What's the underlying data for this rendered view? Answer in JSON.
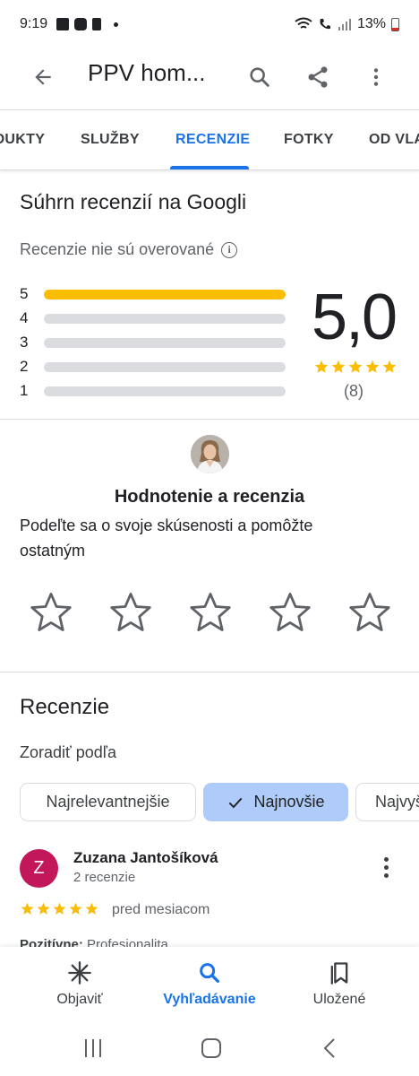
{
  "status_bar": {
    "time": "9:19",
    "battery": "13%"
  },
  "app_bar": {
    "title": "PPV hom..."
  },
  "tabs": [
    {
      "label": "PRODUKTY"
    },
    {
      "label": "SLUŽBY"
    },
    {
      "label": "RECENZIE",
      "active": true
    },
    {
      "label": "FOTKY"
    },
    {
      "label": "OD VLASTNÍKA"
    }
  ],
  "summary": {
    "title": "Súhrn recenzií na Googli",
    "unverified": "Recenzie nie sú overované",
    "distribution": [
      {
        "stars": "5",
        "fraction": 1.0
      },
      {
        "stars": "4",
        "fraction": 0.0
      },
      {
        "stars": "3",
        "fraction": 0.0
      },
      {
        "stars": "2",
        "fraction": 0.0
      },
      {
        "stars": "1",
        "fraction": 0.0
      }
    ],
    "score": "5,0",
    "star_rating": 5,
    "review_count": "(8)"
  },
  "rate": {
    "title": "Hodnotenie a recenzia",
    "description": "Podeľte sa o svoje skúsenosti a pomôžte ostatným"
  },
  "reviews": {
    "title": "Recenzie",
    "sort_label": "Zoradiť podľa",
    "chips": [
      {
        "label": "Najrelevantnejšie"
      },
      {
        "label": "Najnovšie",
        "selected": true
      },
      {
        "label": "Najvyššie"
      }
    ],
    "items": [
      {
        "initial": "Z",
        "name": "Zuzana Jantošíková",
        "meta": "2 recenzie",
        "rating": 5,
        "time": "pred mesiacom",
        "snippet_label": "Pozitívne:",
        "snippet_text": "Profesionalita"
      }
    ]
  },
  "bottom_nav": [
    {
      "label": "Objaviť",
      "icon": "asterisk-icon"
    },
    {
      "label": "Vyhľadávanie",
      "icon": "search-icon",
      "active": true
    },
    {
      "label": "Uložené",
      "icon": "bookmarks-icon"
    }
  ],
  "colors": {
    "accent": "#1a73e8",
    "star": "#fbbc04",
    "avatar": "#c2185b",
    "chip_selected": "#aecbfa"
  }
}
